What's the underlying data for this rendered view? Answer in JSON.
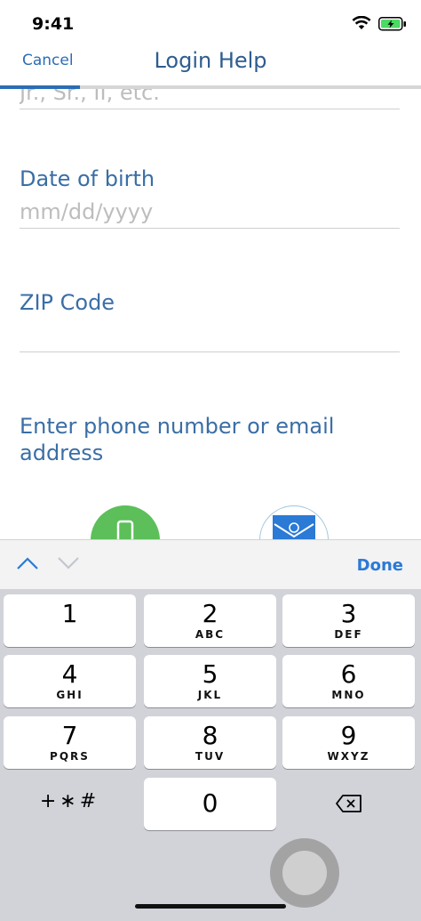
{
  "status_bar": {
    "time": "9:41"
  },
  "nav": {
    "cancel_label": "Cancel",
    "title": "Login Help",
    "progress": 0.19
  },
  "form": {
    "suffix": {
      "placeholder": "Jr., Sr., II, etc."
    },
    "dob": {
      "label": "Date of birth",
      "placeholder": "mm/dd/yyyy"
    },
    "zip": {
      "label": "ZIP Code",
      "placeholder": ""
    },
    "contact": {
      "label": "Enter phone number or email address"
    }
  },
  "accessory": {
    "done_label": "Done"
  },
  "keypad": {
    "keys": [
      {
        "num": "1",
        "letters": ""
      },
      {
        "num": "2",
        "letters": "ABC"
      },
      {
        "num": "3",
        "letters": "DEF"
      },
      {
        "num": "4",
        "letters": "GHI"
      },
      {
        "num": "5",
        "letters": "JKL"
      },
      {
        "num": "6",
        "letters": "MNO"
      },
      {
        "num": "7",
        "letters": "PQRS"
      },
      {
        "num": "8",
        "letters": "TUV"
      },
      {
        "num": "9",
        "letters": "WXYZ"
      },
      {
        "num": "0",
        "letters": ""
      }
    ],
    "symbols_label": "+∗#"
  },
  "colors": {
    "accent": "#2a6db6",
    "label": "#3a6ea5",
    "phone": "#5cbf5a"
  },
  "icons": [
    "wifi-icon",
    "battery-icon",
    "phone-icon",
    "email-icon",
    "chevron-up-icon",
    "chevron-down-icon",
    "delete-icon"
  ]
}
